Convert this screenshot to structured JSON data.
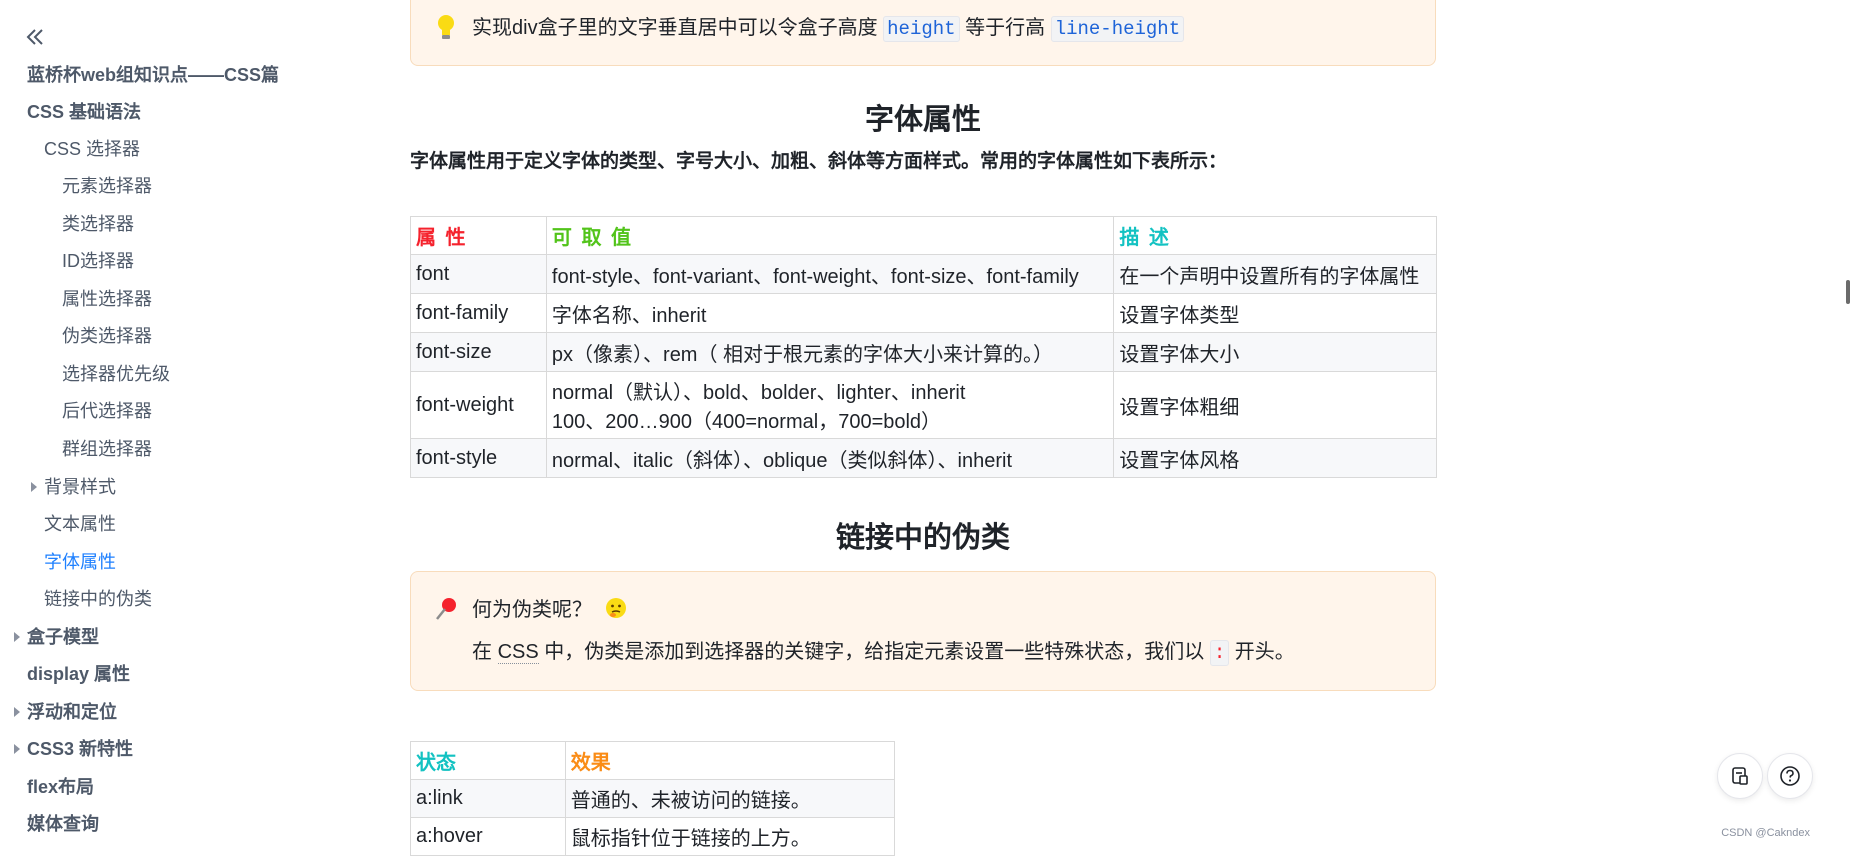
{
  "sidebar": {
    "items": [
      {
        "label": "蓝桥杯web组知识点——CSS篇"
      },
      {
        "label": "CSS 基础语法"
      },
      {
        "label": "CSS 选择器"
      },
      {
        "label": "元素选择器"
      },
      {
        "label": "类选择器"
      },
      {
        "label": "ID选择器"
      },
      {
        "label": "属性选择器"
      },
      {
        "label": "伪类选择器"
      },
      {
        "label": "选择器优先级"
      },
      {
        "label": "后代选择器"
      },
      {
        "label": "群组选择器"
      },
      {
        "label": "背景样式"
      },
      {
        "label": "文本属性"
      },
      {
        "label": "字体属性"
      },
      {
        "label": "链接中的伪类"
      },
      {
        "label": "盒子模型"
      },
      {
        "label": "display 属性"
      },
      {
        "label": "浮动和定位"
      },
      {
        "label": "CSS3 新特性"
      },
      {
        "label": "flex布局"
      },
      {
        "label": "媒体查询"
      }
    ],
    "active_item": "字体属性"
  },
  "tip": {
    "icon": "lightbulb-icon",
    "text_before": "实现div盒子里的文字垂直居中可以令盒子高度",
    "code1": "height",
    "text_mid": "等于行高",
    "code2": "line-height"
  },
  "font_section": {
    "heading": "字体属性",
    "lead": "字体属性用于定义字体的类型、字号大小、加粗、斜体等方面样式。常用的字体属性如下表所示：",
    "table": {
      "headers": [
        {
          "label": "属 性",
          "color": "#f5222d"
        },
        {
          "label": "可 取 值",
          "color": "#52c41a"
        },
        {
          "label": "描 述",
          "color": "#13c2c2"
        }
      ],
      "rows": [
        {
          "prop": "font",
          "values": "font-style、font-variant、font-weight、font-size、font-family",
          "desc": "在一个声明中设置所有的字体属性"
        },
        {
          "prop": "font-family",
          "values": "字体名称、inherit",
          "desc": "设置字体类型"
        },
        {
          "prop": "font-size",
          "values": "px（像素）、rem（ 相对于根元素的字体大小来计算的。）",
          "desc": "设置字体大小"
        },
        {
          "prop": "font-weight",
          "values": "normal（默认）、bold、bolder、lighter、inherit",
          "values2": "100、200…900（400=normal，700=bold）",
          "desc": "设置字体粗细"
        },
        {
          "prop": "font-style",
          "values": "normal、italic（斜体）、oblique（类似斜体）、inherit",
          "desc": "设置字体风格"
        }
      ]
    }
  },
  "link_section": {
    "heading": "链接中的伪类",
    "callout": {
      "pin_icon": "pushpin-icon",
      "question": "何为伪类呢？",
      "emoji_icon": "thinking-face-icon",
      "text_before": "在",
      "abbr": "CSS",
      "text_after": "中，伪类是添加到选择器的关键字，给指定元素设置一些特殊状态，我们以",
      "code": ":",
      "text_end": "开头。"
    },
    "table": {
      "headers": [
        {
          "label": "状态",
          "color": "#13c2c2"
        },
        {
          "label": "效果",
          "color": "#fa8c16"
        }
      ],
      "rows": [
        {
          "state": "a:link",
          "effect": "普通的、未被访问的链接。"
        },
        {
          "state": "a:hover",
          "effect": "鼠标指针位于链接的上方。"
        }
      ]
    }
  },
  "floating": {
    "note_button_icon": "note-icon",
    "help_button_icon": "help-icon"
  },
  "watermark": "CSDN @Cakndex"
}
